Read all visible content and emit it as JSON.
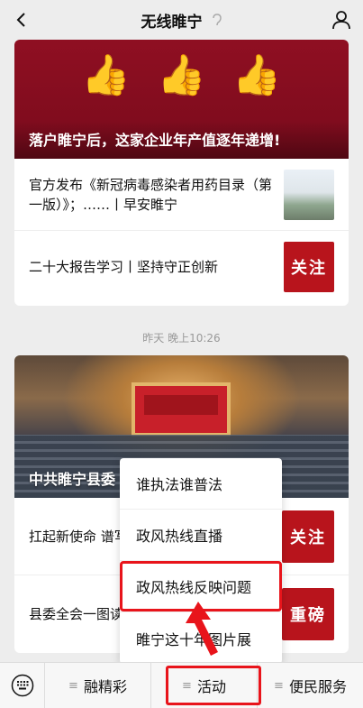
{
  "header": {
    "title": "无线睢宁",
    "back_icon": "chevron-left-icon",
    "ear_icon": "ear-icon",
    "profile_icon": "person-icon"
  },
  "card1": {
    "hero_caption": "落户睢宁后，这家企业年产值逐年递增!",
    "hero_icons": "👍👍👍",
    "items": [
      {
        "title": "官方发布《新冠病毒感染者用药目录（第一版）》；……丨早安睢宁"
      },
      {
        "title": "二十大报告学习丨坚持守正创新",
        "thumb_text": "关注"
      }
    ]
  },
  "timestamp": "昨天 晚上10:26",
  "card2": {
    "hero_caption": "中共睢宁县委",
    "items": [
      {
        "title": "扛起新使命 谱写",
        "thumb_text": "关注"
      },
      {
        "title": "县委全会一图读",
        "thumb_text": "重磅"
      }
    ]
  },
  "popup_menu": {
    "items": [
      "谁执法谁普法",
      "政风热线直播",
      "政风热线反映问题",
      "睢宁这十年图片展"
    ],
    "highlighted_index": 2
  },
  "bottom_bar": {
    "keyboard_icon": "keyboard-icon",
    "tabs": [
      {
        "label": "融精彩"
      },
      {
        "label": "活动"
      },
      {
        "label": "便民服务"
      }
    ],
    "highlighted_tab": 1
  },
  "colors": {
    "highlight": "#e8141b",
    "hero_red": "#8f0f22",
    "thumb_red": "#b8141c"
  }
}
